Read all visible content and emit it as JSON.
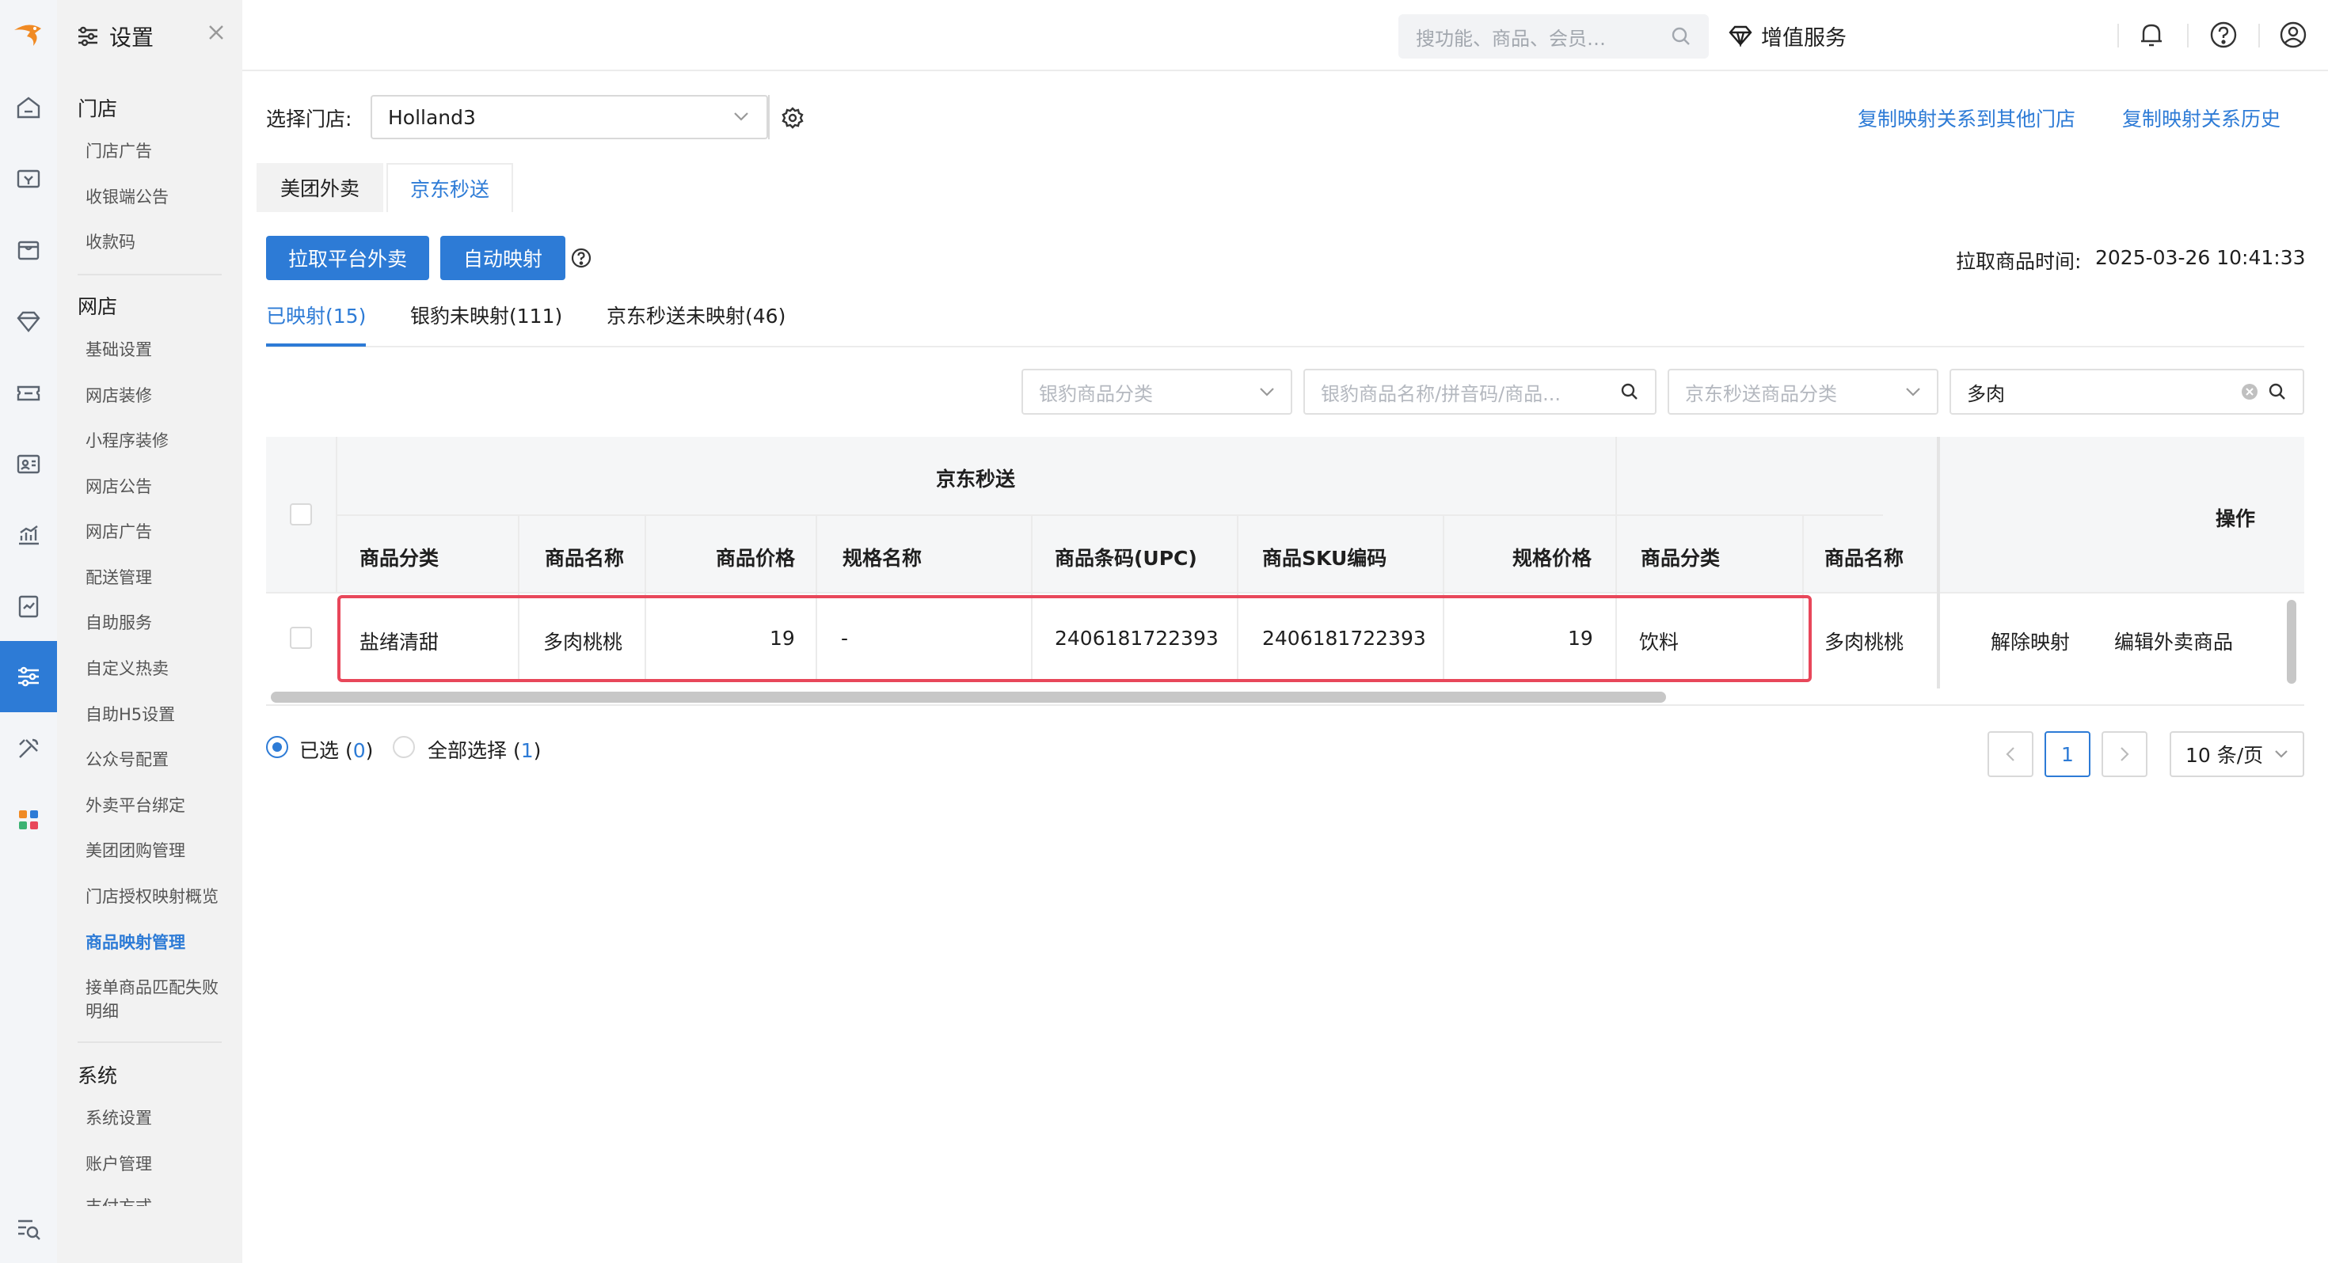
{
  "colors": {
    "accent": "#2d7bd6",
    "highlight_border": "#e8475a",
    "sidebar_bg": "#f2f2f2"
  },
  "rail": {
    "icons": [
      "logo-icon",
      "home-icon",
      "cashier-icon",
      "shop-icon",
      "diamond-icon",
      "ticket-icon",
      "member-card-icon",
      "chart-icon",
      "report-icon",
      "settings-sliders-icon",
      "tools-icon",
      "apps-icon",
      "menu-search-icon"
    ],
    "active": "settings-sliders-icon"
  },
  "sidebar": {
    "title": "设置",
    "sections": [
      {
        "title": "门店",
        "items": [
          "门店广告",
          "收银端公告",
          "收款码"
        ]
      },
      {
        "title": "网店",
        "items": [
          "基础设置",
          "网店装修",
          "小程序装修",
          "网店公告",
          "网店广告",
          "配送管理",
          "自助服务",
          "自定义热卖",
          "自助H5设置",
          "公众号配置",
          "外卖平台绑定",
          "美团团购管理",
          "门店授权映射概览",
          "商品映射管理",
          "接单商品匹配失败明细"
        ]
      },
      {
        "title": "系统",
        "items": [
          "系统设置",
          "账户管理",
          "支付方式"
        ]
      }
    ],
    "active_item": "商品映射管理"
  },
  "topbar": {
    "search_placeholder": "搜功能、商品、会员…",
    "value_added": "增值服务"
  },
  "main": {
    "store_label": "选择门店:",
    "store_value": "Holland3",
    "copy_to_other": "复制映射关系到其他门店",
    "copy_history": "复制映射关系历史",
    "platform_tabs": [
      "美团外卖",
      "京东秒送"
    ],
    "active_platform": "京东秒送",
    "buttons": {
      "pull": "拉取平台外卖",
      "auto_map": "自动映射"
    },
    "pull_time_label": "拉取商品时间:",
    "pull_time": "2025-03-26 10:41:33",
    "status_tabs": [
      "已映射(15)",
      "银豹未映射(111)",
      "京东秒送未映射(46)"
    ],
    "active_status": "已映射(15)",
    "filters": {
      "yinbao_category": "银豹商品分类",
      "yinbao_search": "银豹商品名称/拼音码/商品...",
      "jd_category": "京东秒送商品分类",
      "jd_search_value": "多肉"
    }
  },
  "table": {
    "group_header": "京东秒送",
    "action_header": "操作",
    "columns": [
      "商品分类",
      "商品名称",
      "商品价格",
      "规格名称",
      "商品条码(UPC)",
      "商品SKU编码",
      "规格价格",
      "商品分类",
      "商品名称"
    ],
    "rows": [
      {
        "cells": [
          "盐绪清甜",
          "多肉桃桃",
          "19",
          "-",
          "2406181722393",
          "2406181722393",
          "19",
          "饮料",
          "多肉桃桃"
        ],
        "actions": [
          "解除映射",
          "编辑外卖商品"
        ]
      }
    ]
  },
  "footer": {
    "selected_label": "已选 (",
    "selected_count": "0",
    "all_label": "全部选择 (",
    "all_count": "1",
    "close_paren": ")",
    "page": "1",
    "page_size": "10 条/页"
  }
}
